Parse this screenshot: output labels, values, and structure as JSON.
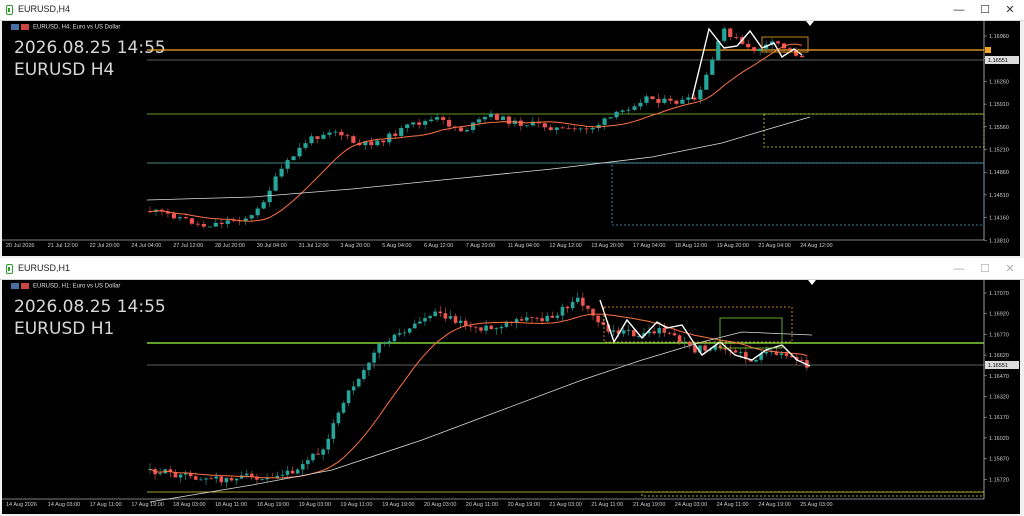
{
  "windows": [
    {
      "title": "EURUSD,H4",
      "header": "EURUSD, H4:  Euro vs US Dollar",
      "overlay_date": "2026.08.25 14:55",
      "overlay_symbol": "EURUSD H4",
      "price_labels": [
        "1.16960",
        "1.16610",
        "1.16260",
        "1.15910",
        "1.15560",
        "1.15210",
        "1.14860",
        "1.14510",
        "1.14160",
        "1.13810"
      ],
      "current_price": "1.16551",
      "time_labels": [
        "20 Jul 2026",
        "21 Jul 12:00",
        "22 Jul 20:00",
        "24 Jul 04:00",
        "27 Jul 12:00",
        "28 Jul 20:00",
        "30 Jul 04:00",
        "31 Jul 12:00",
        "3 Aug 20:00",
        "5 Aug 04:00",
        "6 Aug 12:00",
        "7 Aug 20:00",
        "11 Aug 04:00",
        "12 Aug 12:00",
        "13 Aug 20:00",
        "17 Aug 04:00",
        "18 Aug 12:00",
        "19 Aug 20:00",
        "21 Aug 04:00",
        "24 Aug 12:00"
      ]
    },
    {
      "title": "EURUSD,H1",
      "header": "EURUSD, H1:  Euro vs US Dollar",
      "overlay_date": "2026.08.25 14:55",
      "overlay_symbol": "EURUSD H1",
      "price_labels": [
        "1.17070",
        "1.16920",
        "1.16770",
        "1.16620",
        "1.16470",
        "1.16320",
        "1.16170",
        "1.16020",
        "1.15870",
        "1.15720"
      ],
      "current_price": "1.16551",
      "time_labels": [
        "14 Aug 2026",
        "14 Aug 03:00",
        "17 Aug 11:00",
        "17 Aug 19:00",
        "18 Aug 03:00",
        "18 Aug 11:00",
        "18 Aug 19:00",
        "19 Aug 03:00",
        "19 Aug 11:00",
        "19 Aug 19:00",
        "20 Aug 03:00",
        "20 Aug 11:00",
        "20 Aug 19:00",
        "21 Aug 03:00",
        "21 Aug 11:00",
        "21 Aug 19:00",
        "24 Aug 03:00",
        "24 Aug 11:00",
        "24 Aug 19:00",
        "25 Aug 03:00"
      ]
    }
  ],
  "controls": {
    "minimize": "—",
    "maximize": "☐",
    "close": "✕"
  },
  "colors": {
    "background": "#000000",
    "bull": "#26a69a",
    "bear": "#ef5350",
    "ma_fast": "#ff7043",
    "ma_slow": "#dddddd",
    "level_orange": "#f5a623",
    "level_green": "#7fd13b",
    "level_teal": "#5fb3b3",
    "zigzag": "#ffffff"
  }
}
